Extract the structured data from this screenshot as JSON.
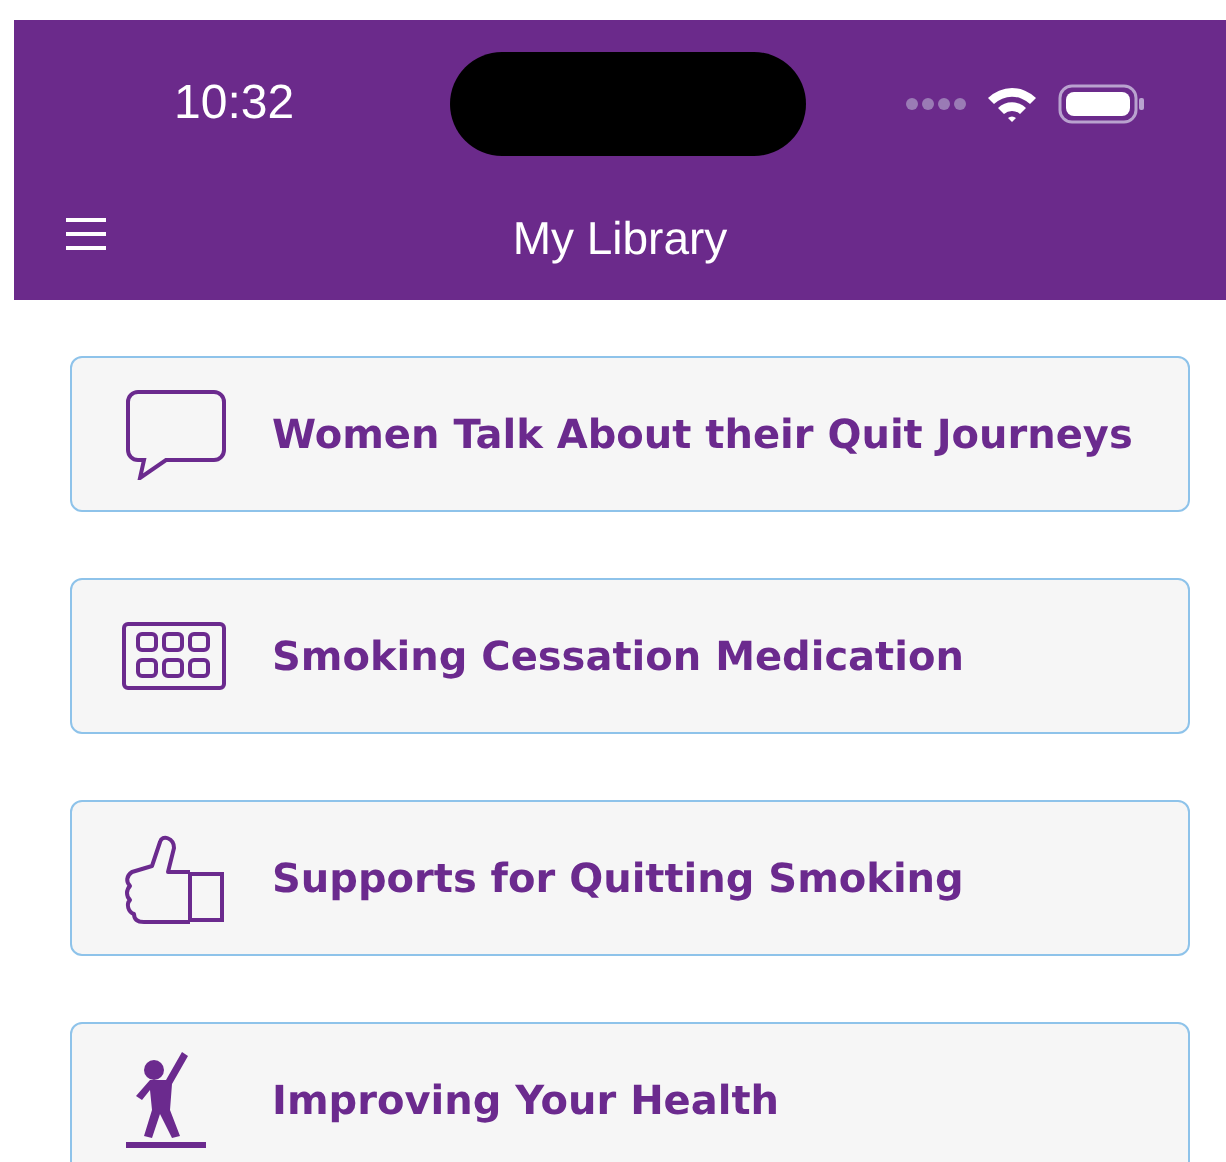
{
  "status_bar": {
    "time": "10:32"
  },
  "header": {
    "title": "My Library"
  },
  "items": [
    {
      "kind": "speech",
      "label": "Women Talk About their Quit Journeys"
    },
    {
      "kind": "pills",
      "label": "Smoking Cessation Medication"
    },
    {
      "kind": "thumb",
      "label": "Supports for Quitting Smoking"
    },
    {
      "kind": "exercise",
      "label": "Improving Your Health"
    }
  ]
}
